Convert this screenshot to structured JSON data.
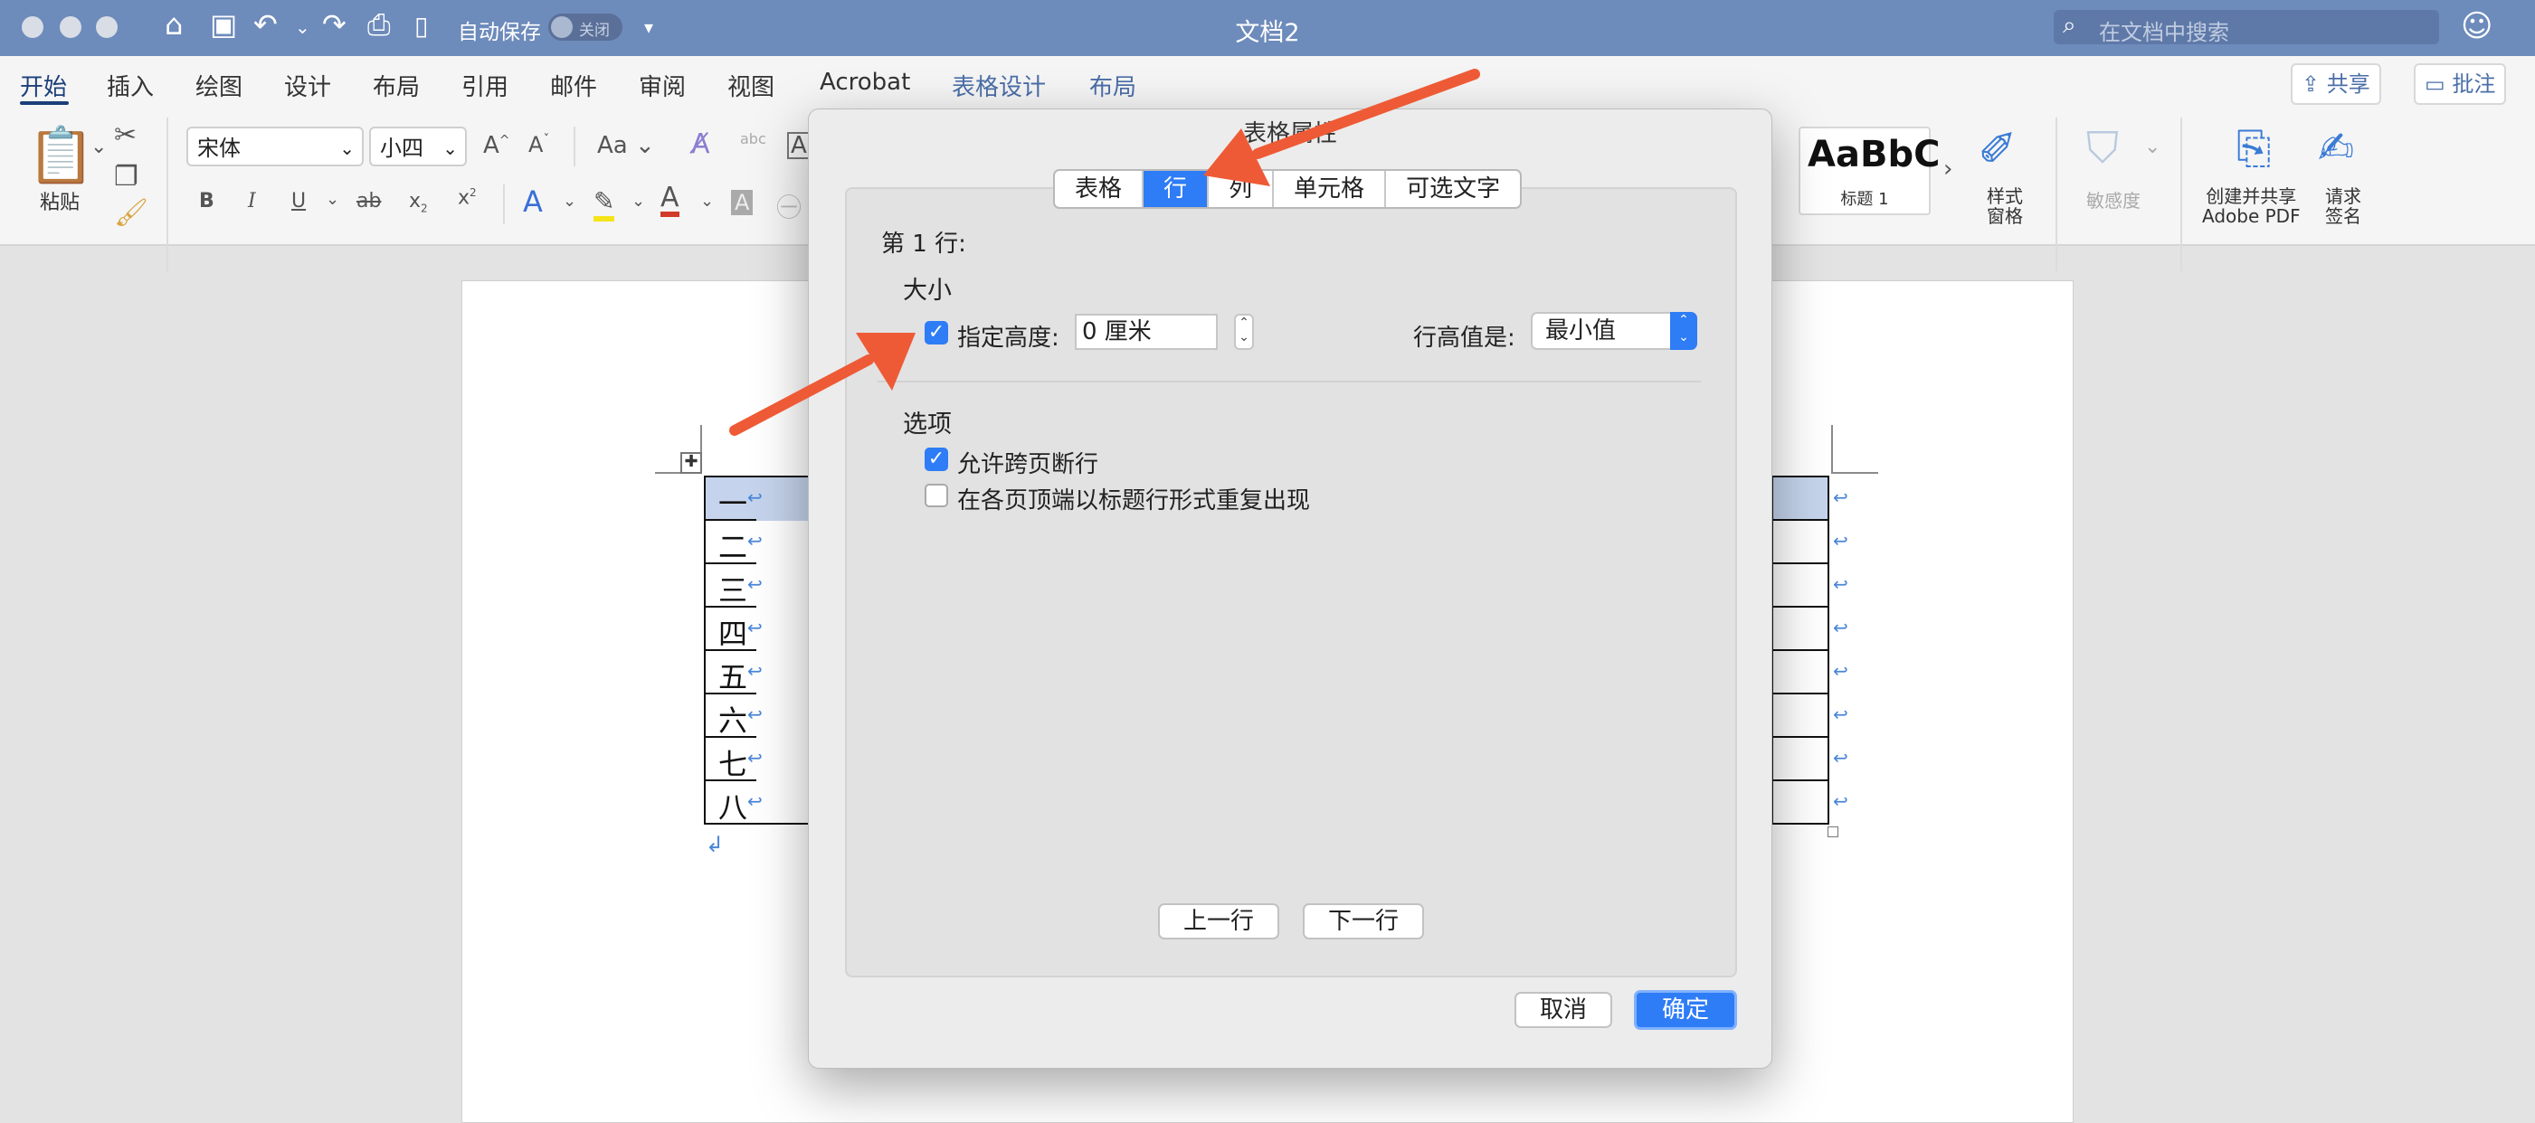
{
  "window": {
    "title": "文档2",
    "autosave_label": "自动保存",
    "autosave_state": "关闭",
    "search_placeholder": "在文档中搜索"
  },
  "ribbon_tabs": [
    {
      "label": "开始",
      "active": true
    },
    {
      "label": "插入"
    },
    {
      "label": "绘图"
    },
    {
      "label": "设计"
    },
    {
      "label": "布局"
    },
    {
      "label": "引用"
    },
    {
      "label": "邮件"
    },
    {
      "label": "审阅"
    },
    {
      "label": "视图"
    },
    {
      "label": "Acrobat"
    },
    {
      "label": "表格设计"
    },
    {
      "label": "布局"
    }
  ],
  "ribbon_actions": {
    "share": "共享",
    "comment": "批注"
  },
  "home_ribbon": {
    "paste_label": "粘贴",
    "font_name": "宋体",
    "font_size": "小四",
    "style_sample": "AaBbC",
    "style_name": "标题 1",
    "styles_pane": [
      "样式",
      "窗格"
    ],
    "sensitivity": "敏感度",
    "create_share_pdf": [
      "创建并共享",
      "Adobe PDF"
    ],
    "request_sign": [
      "请求",
      "签名"
    ],
    "bold": "B",
    "italic": "I",
    "underline": "U",
    "strike": "ab",
    "subscript": "x",
    "superscript": "x",
    "font_size_grow": "A",
    "font_size_shrink": "A",
    "change_case": "Aa",
    "text_effects": "A",
    "font_color": "A",
    "char_shading": "A"
  },
  "table_rows": [
    "一",
    "二",
    "三",
    "四",
    "五",
    "六",
    "七",
    "八"
  ],
  "dialog": {
    "title": "表格属性",
    "tabs": [
      {
        "label": "表格"
      },
      {
        "label": "行",
        "active": true
      },
      {
        "label": "列"
      },
      {
        "label": "单元格"
      },
      {
        "label": "可选文字"
      }
    ],
    "row_heading": "第 1 行:",
    "size_section": "大小",
    "specify_height_label": "指定高度:",
    "specify_height_checked": true,
    "height_value": "0 厘米",
    "row_height_is_label": "行高值是:",
    "row_height_is_value": "最小值",
    "options_section": "选项",
    "allow_break_label": "允许跨页断行",
    "allow_break_checked": true,
    "repeat_header_label": "在各页顶端以标题行形式重复出现",
    "repeat_header_checked": false,
    "prev_row": "上一行",
    "next_row": "下一行",
    "cancel": "取消",
    "ok": "确定"
  },
  "colors": {
    "titlebar": "#6d8bbb",
    "accent": "#2e7cf6",
    "arrow": "#ee5a36",
    "selected_row": "#c5d4ec"
  }
}
